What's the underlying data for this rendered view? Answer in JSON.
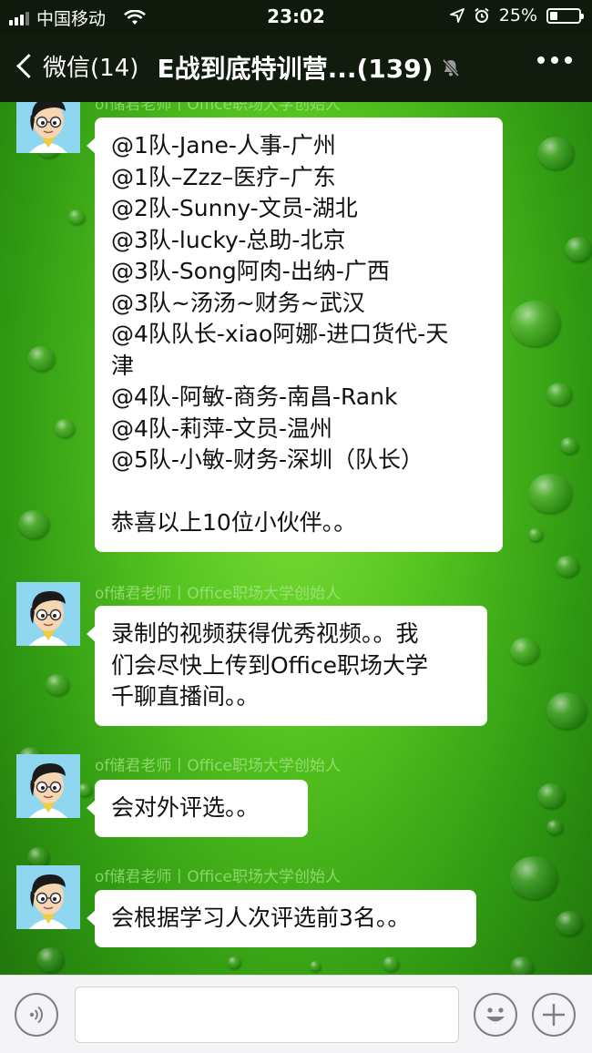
{
  "status_bar": {
    "carrier": "中国移动",
    "time": "23:02",
    "battery_text": "25%",
    "battery_level": 0.25,
    "icons": [
      "signal-icon",
      "wifi-icon",
      "location-icon",
      "alarm-icon",
      "battery-icon"
    ]
  },
  "nav": {
    "back_label": "微信(14)",
    "title": "E战到底特训营...(139)",
    "icons": [
      "back-chevron-icon",
      "mute-icon",
      "more-icon"
    ]
  },
  "messages": [
    {
      "sender": "of储君老师丨Office职场大学创始人",
      "lines": [
        "@1队-Jane-人事-广州",
        "@1队–Zzz–医疗–广东",
        "@2队-Sunny-文员-湖北",
        "@3队-lucky-总助-北京",
        "@3队-Song阿肉-出纳-广西",
        "@3队~汤汤~财务~武汉",
        "@4队队长-xiao阿娜-进口货代-天",
        "津",
        "@4队-阿敏-商务-南昌-Rank",
        "@4队-莉萍-文员-温州",
        "@5队-小敏-财务-深圳（队长）",
        "",
        "恭喜以上10位小伙伴。。"
      ]
    },
    {
      "sender": "of储君老师丨Office职场大学创始人",
      "lines": [
        "录制的视频获得优秀视频。。我",
        "们会尽快上传到Office职场大学",
        "千聊直播间。。"
      ]
    },
    {
      "sender": "of储君老师丨Office职场大学创始人",
      "lines": [
        "会对外评选。。"
      ]
    },
    {
      "sender": "of储君老师丨Office职场大学创始人",
      "lines": [
        "会根据学习人次评选前3名。。"
      ]
    }
  ],
  "input_bar": {
    "icons": [
      "voice-icon",
      "emoji-icon",
      "plus-icon"
    ],
    "input_value": ""
  },
  "colors": {
    "nav_background": "#111b0e",
    "bubble_background": "#ffffff",
    "wallpaper": "#4fbf1e"
  }
}
